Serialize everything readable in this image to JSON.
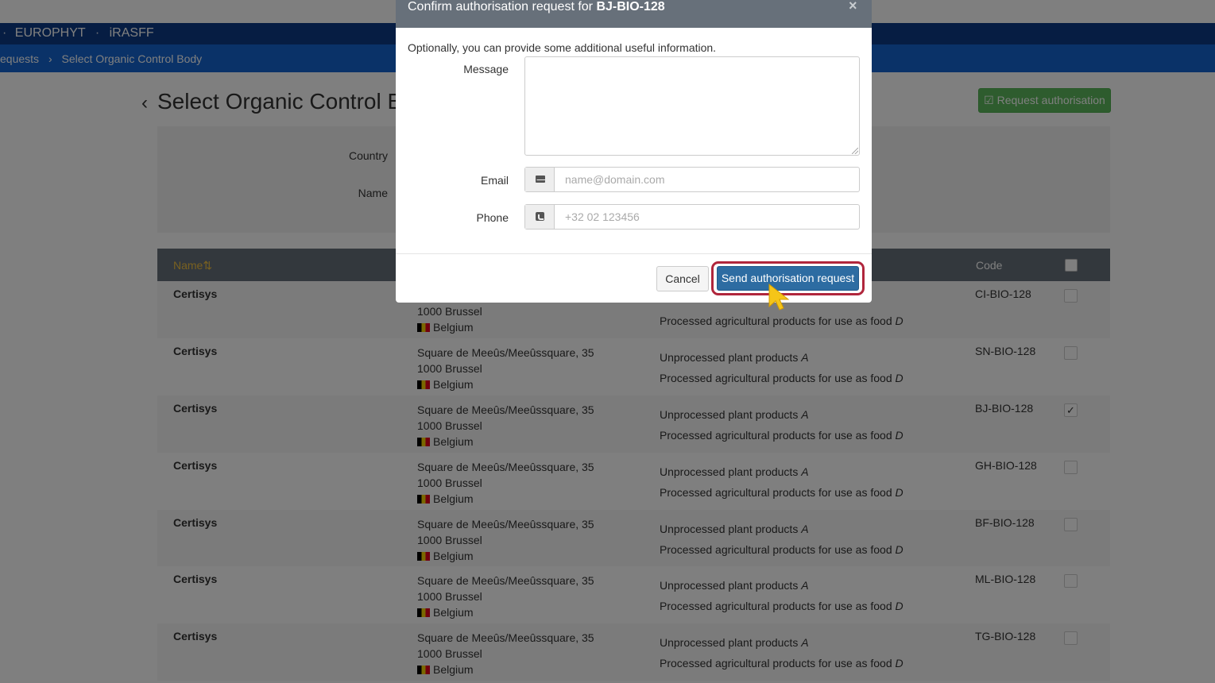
{
  "topnav": {
    "items": [
      "EUROPHYT",
      "iRASFF"
    ]
  },
  "breadcrumb": {
    "items": [
      "equests",
      "Select Organic Control Body"
    ]
  },
  "page": {
    "title": "Select Organic Control B",
    "request_button": "Request authorisation"
  },
  "filters": {
    "country_label": "Country",
    "name_label": "Name"
  },
  "table": {
    "columns": {
      "name": "Name",
      "code": "Code"
    },
    "rows": [
      {
        "name": "Certisys",
        "address": "",
        "city": "1000 Brussel",
        "country": "Belgium",
        "product1": "",
        "product1_cat": "",
        "product2": "Processed agricultural products for use as food",
        "product2_cat": "D",
        "code": "CI-BIO-128",
        "checked": false
      },
      {
        "name": "Certisys",
        "address": "Square de Meeûs/Meeûssquare, 35",
        "city": "1000 Brussel",
        "country": "Belgium",
        "product1": "Unprocessed plant products",
        "product1_cat": "A",
        "product2": "Processed agricultural products for use as food",
        "product2_cat": "D",
        "code": "SN-BIO-128",
        "checked": false
      },
      {
        "name": "Certisys",
        "address": "Square de Meeûs/Meeûssquare, 35",
        "city": "1000 Brussel",
        "country": "Belgium",
        "product1": "Unprocessed plant products",
        "product1_cat": "A",
        "product2": "Processed agricultural products for use as food",
        "product2_cat": "D",
        "code": "BJ-BIO-128",
        "checked": true
      },
      {
        "name": "Certisys",
        "address": "Square de Meeûs/Meeûssquare, 35",
        "city": "1000 Brussel",
        "country": "Belgium",
        "product1": "Unprocessed plant products",
        "product1_cat": "A",
        "product2": "Processed agricultural products for use as food",
        "product2_cat": "D",
        "code": "GH-BIO-128",
        "checked": false
      },
      {
        "name": "Certisys",
        "address": "Square de Meeûs/Meeûssquare, 35",
        "city": "1000 Brussel",
        "country": "Belgium",
        "product1": "Unprocessed plant products",
        "product1_cat": "A",
        "product2": "Processed agricultural products for use as food",
        "product2_cat": "D",
        "code": "BF-BIO-128",
        "checked": false
      },
      {
        "name": "Certisys",
        "address": "Square de Meeûs/Meeûssquare, 35",
        "city": "1000 Brussel",
        "country": "Belgium",
        "product1": "Unprocessed plant products",
        "product1_cat": "A",
        "product2": "Processed agricultural products for use as food",
        "product2_cat": "D",
        "code": "ML-BIO-128",
        "checked": false
      },
      {
        "name": "Certisys",
        "address": "Square de Meeûs/Meeûssquare, 35",
        "city": "1000 Brussel",
        "country": "Belgium",
        "product1": "Unprocessed plant products",
        "product1_cat": "A",
        "product2": "Processed agricultural products for use as food",
        "product2_cat": "D",
        "code": "TG-BIO-128",
        "checked": false
      }
    ]
  },
  "modal": {
    "title_prefix": "Confirm authorisation request for",
    "title_code": "BJ-BIO-128",
    "close": "×",
    "intro": "Optionally, you can provide some additional useful information.",
    "message_label": "Message",
    "message_value": "",
    "email_label": "Email",
    "email_placeholder": "name@domain.com",
    "email_icon": "envelope-icon",
    "phone_label": "Phone",
    "phone_placeholder": "+32 02 123456",
    "phone_icon": "phone-icon",
    "cancel_label": "Cancel",
    "send_label": "Send authorisation request"
  },
  "colors": {
    "navbar": "#0d3b86",
    "breadbar": "#1565d0",
    "primary_button": "#2d6ca2",
    "success_button": "#5cb85c",
    "highlight_ring": "#b0263c",
    "cursor": "#f5c518"
  }
}
